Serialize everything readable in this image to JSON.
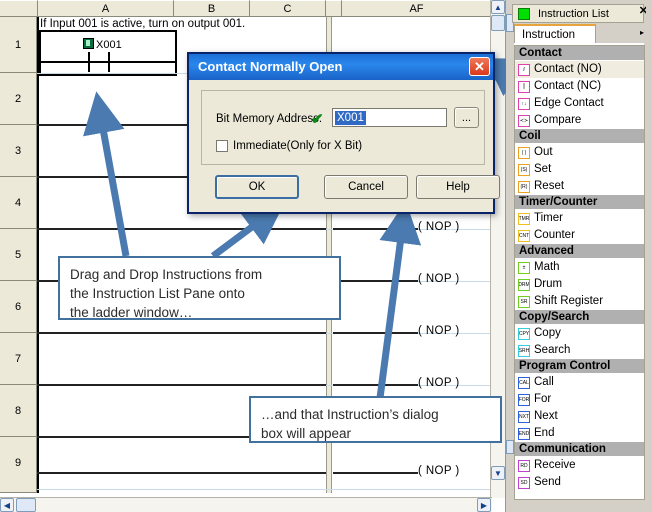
{
  "grid": {
    "column_headers": [
      "A",
      "B",
      "C",
      "AF"
    ],
    "row_numbers": [
      "1",
      "2",
      "3",
      "4",
      "5",
      "6",
      "7",
      "8",
      "9"
    ],
    "rung_comment": "If Input 001 is active, turn on output 001.",
    "contact_label": "X001",
    "nop_label": "( NOP )",
    "nop_rows": [
      4,
      5,
      6,
      7,
      9
    ]
  },
  "dialog": {
    "title": "Contact Normally Open",
    "close_label": "✕",
    "address_label": "Bit Memory Address:",
    "valid_check": "✔",
    "address_value": "X001",
    "browse_label": "...",
    "immediate_label": "Immediate(Only for X Bit)",
    "ok_label": "OK",
    "cancel_label": "Cancel",
    "help_label": "Help"
  },
  "callouts": {
    "one": [
      "Drag and Drop Instructions from",
      "the Instruction List Pane onto",
      "the ladder window…"
    ],
    "two": [
      "…and that Instruction’s dialog",
      "box will appear"
    ]
  },
  "instruction_list": {
    "window_title": "Instruction List",
    "close_label": "✕",
    "tab_label": "Instruction",
    "overflow_label": "▸",
    "groups": [
      {
        "name": "Contact",
        "color": "#e040b0",
        "items": [
          {
            "label": "Contact (NO)",
            "icon": "contact-no-icon",
            "glyph": "⫽",
            "selected": true
          },
          {
            "label": "Contact (NC)",
            "icon": "contact-nc-icon",
            "glyph": "⫿",
            "selected": false
          },
          {
            "label": "Edge Contact",
            "icon": "edge-contact-icon",
            "glyph": "↑↓",
            "selected": false
          },
          {
            "label": "Compare",
            "icon": "compare-icon",
            "glyph": "≺≻",
            "selected": false
          }
        ]
      },
      {
        "name": "Coil",
        "color": "#f0a020",
        "items": [
          {
            "label": "Out",
            "icon": "coil-out-icon",
            "glyph": "( )",
            "selected": false
          },
          {
            "label": "Set",
            "icon": "coil-set-icon",
            "glyph": "(S)",
            "selected": false
          },
          {
            "label": "Reset",
            "icon": "coil-reset-icon",
            "glyph": "(R)",
            "selected": false
          }
        ]
      },
      {
        "name": "Timer/Counter",
        "color": "#f0c020",
        "items": [
          {
            "label": "Timer",
            "icon": "timer-icon",
            "glyph": "TMR",
            "selected": false
          },
          {
            "label": "Counter",
            "icon": "counter-icon",
            "glyph": "CNT",
            "selected": false
          }
        ]
      },
      {
        "name": "Advanced",
        "color": "#70d020",
        "items": [
          {
            "label": "Math",
            "icon": "math-icon",
            "glyph": "±",
            "selected": false
          },
          {
            "label": "Drum",
            "icon": "drum-icon",
            "glyph": "DRM",
            "selected": false
          },
          {
            "label": "Shift Register",
            "icon": "shift-register-icon",
            "glyph": "SR",
            "selected": false
          }
        ]
      },
      {
        "name": "Copy/Search",
        "color": "#30d0e0",
        "items": [
          {
            "label": "Copy",
            "icon": "copy-icon",
            "glyph": "CPY",
            "selected": false
          },
          {
            "label": "Search",
            "icon": "search-icon",
            "glyph": "SRH",
            "selected": false
          }
        ]
      },
      {
        "name": "Program Control",
        "color": "#3060e0",
        "items": [
          {
            "label": "Call",
            "icon": "call-icon",
            "glyph": "CAL",
            "selected": false
          },
          {
            "label": "For",
            "icon": "for-icon",
            "glyph": "FOR",
            "selected": false
          },
          {
            "label": "Next",
            "icon": "next-icon",
            "glyph": "NXT",
            "selected": false
          },
          {
            "label": "End",
            "icon": "end-icon",
            "glyph": "END",
            "selected": false
          }
        ]
      },
      {
        "name": "Communication",
        "color": "#c040d0",
        "items": [
          {
            "label": "Receive",
            "icon": "receive-icon",
            "glyph": "RD",
            "selected": false
          },
          {
            "label": "Send",
            "icon": "send-icon",
            "glyph": "SD",
            "selected": false
          }
        ]
      }
    ]
  },
  "scrollbars": {
    "up_arrow": "▲",
    "down_arrow": "▼",
    "left_arrow": "◀",
    "right_arrow": "▶"
  }
}
